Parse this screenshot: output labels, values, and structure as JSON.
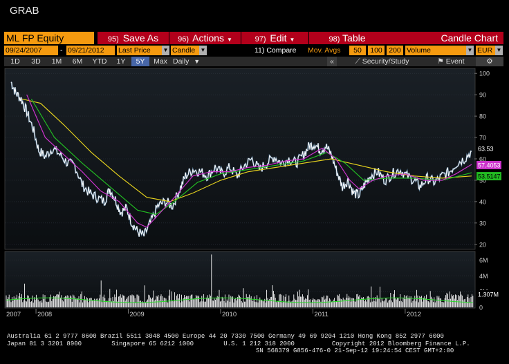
{
  "app": {
    "title": "GRAB"
  },
  "toolbar": {
    "security": "ML FP Equity",
    "save_num": "95)",
    "save_label": "Save As",
    "actions_num": "96)",
    "actions_label": "Actions",
    "edit_num": "97)",
    "edit_label": "Edit",
    "table_num": "98)",
    "table_label": "Table",
    "chart_name": "Candle Chart"
  },
  "settings": {
    "start_date": "09/24/2007",
    "dash": "-",
    "end_date": "09/21/2012",
    "price_type": "Last Price",
    "chart_style": "Candle",
    "compare": "11) Compare",
    "mov_avgs_label": "Mov. Avgs",
    "ma1": "50",
    "ma2": "100",
    "ma3": "200",
    "lower_study": "Volume",
    "currency": "EUR",
    "dropdown_glyph": "▼"
  },
  "timebar": {
    "periods": [
      "1D",
      "3D",
      "1M",
      "6M",
      "YTD",
      "1Y",
      "5Y",
      "Max"
    ],
    "selected": "5Y",
    "frequency": "Daily",
    "collapse": "«",
    "study_label": "Security/Study",
    "event_label": "Event",
    "settings_icon": "gear-icon"
  },
  "colors": {
    "orange": "#f59a0f",
    "red_button": "#b3001b",
    "price": "#ffffff",
    "ma50": "#cc33cc",
    "ma100": "#22bb22",
    "ma200": "#e6d21e",
    "volume_avg": "#22dd22"
  },
  "chart_data": {
    "type": "line",
    "y_ticks": [
      "100",
      "90",
      "80",
      "70",
      "60",
      "50",
      "40",
      "30",
      "20"
    ],
    "ylim": [
      18,
      102
    ],
    "x_labels": [
      "2007",
      "2008",
      "2009",
      "2010",
      "2011",
      "2012"
    ],
    "last_price": "63.53",
    "ma50_value": "57.4053",
    "ma100_value": "53.5147",
    "volume_ticks": [
      "6M",
      "4M",
      "2M",
      "0"
    ],
    "volume_ylim": [
      0,
      7
    ],
    "volume_value": "1.307M",
    "price_series": [
      {
        "x": 2007.73,
        "y": 96
      },
      {
        "x": 2007.78,
        "y": 91
      },
      {
        "x": 2007.84,
        "y": 88
      },
      {
        "x": 2007.9,
        "y": 82
      },
      {
        "x": 2007.97,
        "y": 74
      },
      {
        "x": 2008.03,
        "y": 64
      },
      {
        "x": 2008.1,
        "y": 61
      },
      {
        "x": 2008.18,
        "y": 65
      },
      {
        "x": 2008.26,
        "y": 62
      },
      {
        "x": 2008.34,
        "y": 58
      },
      {
        "x": 2008.42,
        "y": 57
      },
      {
        "x": 2008.5,
        "y": 48
      },
      {
        "x": 2008.58,
        "y": 44
      },
      {
        "x": 2008.66,
        "y": 42
      },
      {
        "x": 2008.74,
        "y": 40
      },
      {
        "x": 2008.8,
        "y": 46
      },
      {
        "x": 2008.86,
        "y": 41
      },
      {
        "x": 2008.92,
        "y": 35
      },
      {
        "x": 2008.98,
        "y": 37
      },
      {
        "x": 2009.04,
        "y": 30
      },
      {
        "x": 2009.1,
        "y": 26
      },
      {
        "x": 2009.17,
        "y": 24
      },
      {
        "x": 2009.24,
        "y": 30
      },
      {
        "x": 2009.32,
        "y": 38
      },
      {
        "x": 2009.4,
        "y": 40
      },
      {
        "x": 2009.48,
        "y": 38
      },
      {
        "x": 2009.56,
        "y": 46
      },
      {
        "x": 2009.62,
        "y": 52
      },
      {
        "x": 2009.7,
        "y": 55
      },
      {
        "x": 2009.78,
        "y": 54
      },
      {
        "x": 2009.86,
        "y": 52
      },
      {
        "x": 2009.94,
        "y": 56
      },
      {
        "x": 2010.02,
        "y": 53
      },
      {
        "x": 2010.1,
        "y": 56
      },
      {
        "x": 2010.18,
        "y": 52
      },
      {
        "x": 2010.26,
        "y": 57
      },
      {
        "x": 2010.34,
        "y": 60
      },
      {
        "x": 2010.42,
        "y": 55
      },
      {
        "x": 2010.5,
        "y": 58
      },
      {
        "x": 2010.58,
        "y": 61
      },
      {
        "x": 2010.66,
        "y": 58
      },
      {
        "x": 2010.74,
        "y": 60
      },
      {
        "x": 2010.82,
        "y": 58
      },
      {
        "x": 2010.9,
        "y": 62
      },
      {
        "x": 2010.96,
        "y": 66
      },
      {
        "x": 2011.02,
        "y": 67
      },
      {
        "x": 2011.08,
        "y": 64
      },
      {
        "x": 2011.14,
        "y": 66
      },
      {
        "x": 2011.2,
        "y": 62
      },
      {
        "x": 2011.26,
        "y": 54
      },
      {
        "x": 2011.32,
        "y": 47
      },
      {
        "x": 2011.38,
        "y": 50
      },
      {
        "x": 2011.44,
        "y": 44
      },
      {
        "x": 2011.5,
        "y": 43
      },
      {
        "x": 2011.56,
        "y": 48
      },
      {
        "x": 2011.62,
        "y": 52
      },
      {
        "x": 2011.7,
        "y": 54
      },
      {
        "x": 2011.78,
        "y": 50
      },
      {
        "x": 2011.86,
        "y": 53
      },
      {
        "x": 2011.94,
        "y": 55
      },
      {
        "x": 2012.02,
        "y": 52
      },
      {
        "x": 2012.1,
        "y": 50
      },
      {
        "x": 2012.16,
        "y": 47
      },
      {
        "x": 2012.24,
        "y": 51
      },
      {
        "x": 2012.32,
        "y": 49
      },
      {
        "x": 2012.4,
        "y": 52
      },
      {
        "x": 2012.48,
        "y": 54
      },
      {
        "x": 2012.56,
        "y": 58
      },
      {
        "x": 2012.64,
        "y": 60
      },
      {
        "x": 2012.72,
        "y": 63.5
      }
    ],
    "ma50_series": [
      {
        "x": 2007.9,
        "y": 90
      },
      {
        "x": 2008.1,
        "y": 70
      },
      {
        "x": 2008.3,
        "y": 62
      },
      {
        "x": 2008.5,
        "y": 54
      },
      {
        "x": 2008.7,
        "y": 45
      },
      {
        "x": 2008.9,
        "y": 40
      },
      {
        "x": 2009.1,
        "y": 30
      },
      {
        "x": 2009.2,
        "y": 28
      },
      {
        "x": 2009.35,
        "y": 35
      },
      {
        "x": 2009.5,
        "y": 42
      },
      {
        "x": 2009.7,
        "y": 52
      },
      {
        "x": 2009.9,
        "y": 54
      },
      {
        "x": 2010.1,
        "y": 54
      },
      {
        "x": 2010.3,
        "y": 56
      },
      {
        "x": 2010.5,
        "y": 57
      },
      {
        "x": 2010.7,
        "y": 59
      },
      {
        "x": 2010.9,
        "y": 60
      },
      {
        "x": 2011.1,
        "y": 65
      },
      {
        "x": 2011.25,
        "y": 60
      },
      {
        "x": 2011.4,
        "y": 50
      },
      {
        "x": 2011.5,
        "y": 46
      },
      {
        "x": 2011.65,
        "y": 50
      },
      {
        "x": 2011.8,
        "y": 52
      },
      {
        "x": 2012.0,
        "y": 53
      },
      {
        "x": 2012.2,
        "y": 50
      },
      {
        "x": 2012.4,
        "y": 50
      },
      {
        "x": 2012.55,
        "y": 53
      },
      {
        "x": 2012.72,
        "y": 57.4
      }
    ],
    "ma100_series": [
      {
        "x": 2007.95,
        "y": 88
      },
      {
        "x": 2008.2,
        "y": 70
      },
      {
        "x": 2008.5,
        "y": 58
      },
      {
        "x": 2008.8,
        "y": 47
      },
      {
        "x": 2009.1,
        "y": 36
      },
      {
        "x": 2009.3,
        "y": 34
      },
      {
        "x": 2009.5,
        "y": 40
      },
      {
        "x": 2009.75,
        "y": 49
      },
      {
        "x": 2010.0,
        "y": 53
      },
      {
        "x": 2010.3,
        "y": 55
      },
      {
        "x": 2010.6,
        "y": 57
      },
      {
        "x": 2010.9,
        "y": 59
      },
      {
        "x": 2011.15,
        "y": 63
      },
      {
        "x": 2011.35,
        "y": 58
      },
      {
        "x": 2011.55,
        "y": 50
      },
      {
        "x": 2011.8,
        "y": 51
      },
      {
        "x": 2012.1,
        "y": 51
      },
      {
        "x": 2012.4,
        "y": 50
      },
      {
        "x": 2012.72,
        "y": 53.5
      }
    ],
    "ma200_series": [
      {
        "x": 2007.85,
        "y": 88
      },
      {
        "x": 2008.05,
        "y": 86
      },
      {
        "x": 2008.3,
        "y": 76
      },
      {
        "x": 2008.6,
        "y": 63
      },
      {
        "x": 2008.9,
        "y": 52
      },
      {
        "x": 2009.2,
        "y": 42
      },
      {
        "x": 2009.45,
        "y": 40
      },
      {
        "x": 2009.7,
        "y": 44
      },
      {
        "x": 2010.0,
        "y": 50
      },
      {
        "x": 2010.3,
        "y": 54
      },
      {
        "x": 2010.6,
        "y": 56
      },
      {
        "x": 2010.9,
        "y": 58
      },
      {
        "x": 2011.2,
        "y": 60
      },
      {
        "x": 2011.5,
        "y": 57
      },
      {
        "x": 2011.8,
        "y": 54
      },
      {
        "x": 2012.1,
        "y": 52
      },
      {
        "x": 2012.4,
        "y": 51
      },
      {
        "x": 2012.72,
        "y": 52
      }
    ]
  },
  "footer": {
    "line1": "Australia 61 2 9777 8600 Brazil 5511 3048 4500 Europe 44 20 7330 7500 Germany 49 69 9204 1210 Hong Kong 852 2977 6000",
    "line2": "Japan 81 3 3201 8900        Singapore 65 6212 1000        U.S. 1 212 318 2000          Copyright 2012 Bloomberg Finance L.P.",
    "line3": "SN 568379 G856-476-0 21-Sep-12 19:24:54 CEST GMT+2:00"
  }
}
